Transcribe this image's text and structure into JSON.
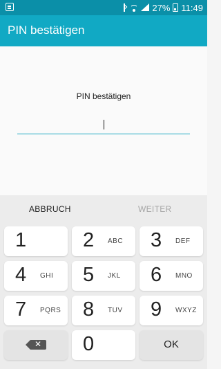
{
  "status_bar": {
    "battery_percent": "27%",
    "time": "11:49"
  },
  "app_bar": {
    "title": "PIN bestätigen"
  },
  "content": {
    "field_label": "PIN bestätigen",
    "field_value": ""
  },
  "actions": {
    "cancel_label": "ABBRUCH",
    "continue_label": "WEITER"
  },
  "keypad": {
    "keys": [
      {
        "number": "1",
        "letters": ""
      },
      {
        "number": "2",
        "letters": "ABC"
      },
      {
        "number": "3",
        "letters": "DEF"
      },
      {
        "number": "4",
        "letters": "GHI"
      },
      {
        "number": "5",
        "letters": "JKL"
      },
      {
        "number": "6",
        "letters": "MNO"
      },
      {
        "number": "7",
        "letters": "PQRS"
      },
      {
        "number": "8",
        "letters": "TUV"
      },
      {
        "number": "9",
        "letters": "WXYZ"
      },
      {
        "number": "0",
        "letters": ""
      }
    ],
    "ok_label": "OK"
  }
}
